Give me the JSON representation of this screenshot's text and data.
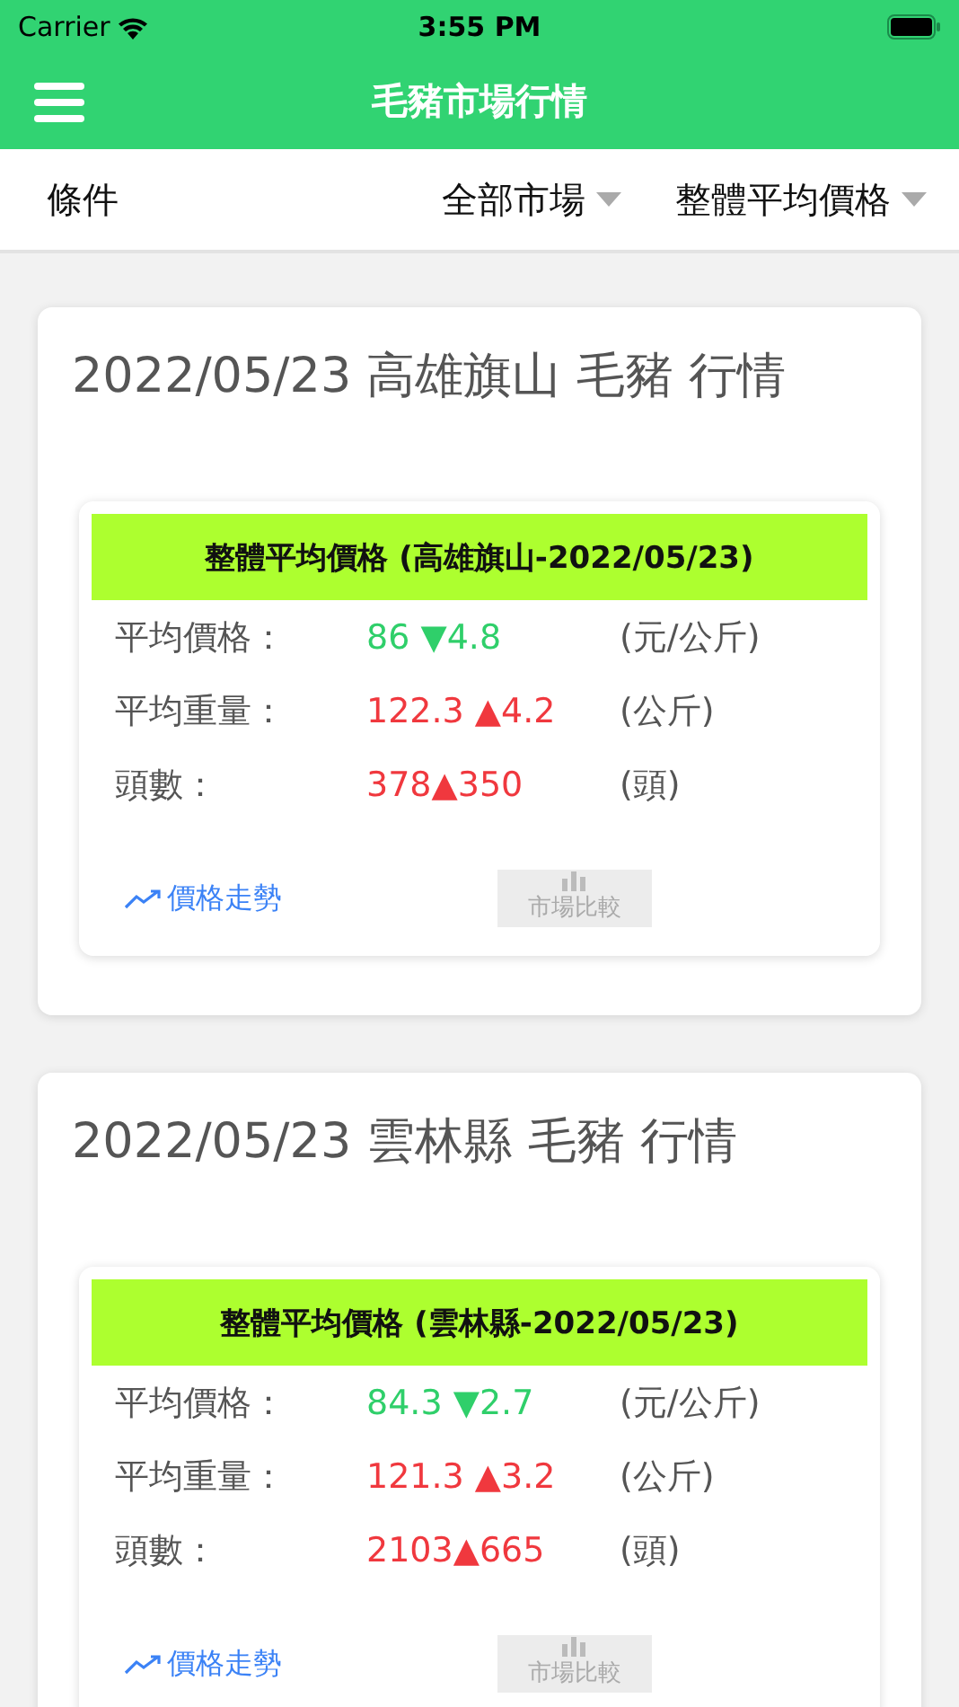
{
  "status_bar": {
    "carrier": "Carrier",
    "time": "3:55 PM"
  },
  "header": {
    "title": "毛豬市場行情"
  },
  "filter": {
    "label": "條件",
    "dropdowns": [
      "全部市場",
      "整體平均價格"
    ]
  },
  "cards": [
    {
      "title": "2022/05/23 高雄旗山 毛豬 行情",
      "panel_title": "整體平均價格 (高雄旗山-2022/05/23)",
      "rows": [
        {
          "label": "平均價格：",
          "value": "86 ▼4.8",
          "kind": "down",
          "unit": "(元/公斤)"
        },
        {
          "label": "平均重量：",
          "value": "122.3 ▲4.2",
          "kind": "up",
          "unit": "(公斤)"
        },
        {
          "label": "頭數：",
          "value": "378▲350",
          "kind": "up",
          "unit": "(頭)"
        }
      ],
      "trend_link": "價格走勢",
      "compare_button": {
        "label": "市場比較",
        "disabled": true
      }
    },
    {
      "title": "2022/05/23 雲林縣 毛豬 行情",
      "panel_title": "整體平均價格 (雲林縣-2022/05/23)",
      "rows": [
        {
          "label": "平均價格：",
          "value": "84.3 ▼2.7",
          "kind": "down",
          "unit": "(元/公斤)"
        },
        {
          "label": "平均重量：",
          "value": "121.3 ▲3.2",
          "kind": "up",
          "unit": "(公斤)"
        },
        {
          "label": "頭數：",
          "value": "2103▲665",
          "kind": "up",
          "unit": "(頭)"
        }
      ],
      "trend_link": "價格走勢",
      "compare_button": {
        "label": "市場比較",
        "disabled": true
      }
    }
  ]
}
